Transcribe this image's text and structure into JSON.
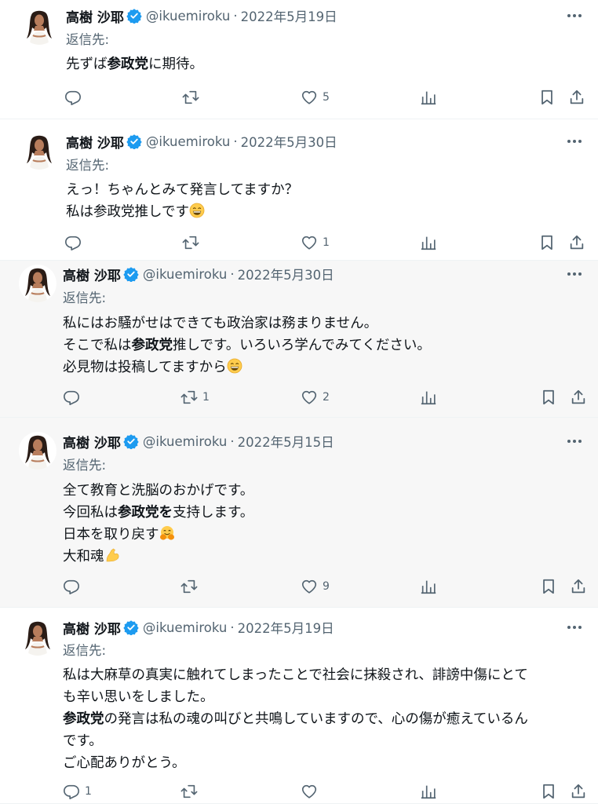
{
  "colors": {
    "text": "#0f1419",
    "muted": "#536471",
    "verified": "#1d9bf0",
    "divider": "#eff3f4",
    "hover_bg": "#f7f7f7"
  },
  "tweets": [
    {
      "name": "高樹 沙耶",
      "handle": "@ikuemiroku",
      "separator": "·",
      "date": "2022年5月19日",
      "reply_to": "返信先:",
      "lines": [
        [
          {
            "t": "先ずば"
          },
          {
            "t": "参政党",
            "b": true
          },
          {
            "t": "に期待。"
          }
        ]
      ],
      "stats": {
        "reply": "",
        "retweet": "",
        "like": "5"
      }
    },
    {
      "name": "高樹 沙耶",
      "handle": "@ikuemiroku",
      "separator": "·",
      "date": "2022年5月30日",
      "reply_to": "返信先:",
      "lines": [
        [
          {
            "t": "えっ！ちゃんとみて発言してますか？"
          }
        ],
        [
          {
            "t": "私は参政党推しです"
          },
          {
            "emoji": "grin"
          }
        ]
      ],
      "stats": {
        "reply": "",
        "retweet": "",
        "like": "1"
      }
    },
    {
      "name": "高樹 沙耶",
      "handle": "@ikuemiroku",
      "separator": "·",
      "date": "2022年5月30日",
      "reply_to": "返信先:",
      "lines": [
        [
          {
            "t": "私にはお騒がせはできても政治家は務まりません。"
          }
        ],
        [
          {
            "t": "そこで私は"
          },
          {
            "t": "参政党",
            "b": true
          },
          {
            "t": "推しです。いろいろ学んでみてください。"
          }
        ],
        [
          {
            "t": "必見物は投稿してますから"
          },
          {
            "emoji": "grin"
          }
        ]
      ],
      "stats": {
        "reply": "",
        "retweet": "1",
        "like": "2"
      }
    },
    {
      "name": "高樹 沙耶",
      "handle": "@ikuemiroku",
      "separator": "·",
      "date": "2022年5月15日",
      "reply_to": "返信先:",
      "lines": [
        [
          {
            "t": "全て教育と洗脳のおかげです。"
          }
        ],
        [
          {
            "t": "今回私は"
          },
          {
            "t": "参政党を",
            "b": true
          },
          {
            "t": "支持します。"
          }
        ],
        [
          {
            "t": "日本を取り戻す"
          },
          {
            "emoji": "hug"
          }
        ],
        [
          {
            "t": "大和魂"
          },
          {
            "emoji": "muscle"
          }
        ]
      ],
      "stats": {
        "reply": "",
        "retweet": "",
        "like": "9"
      }
    },
    {
      "name": "高樹 沙耶",
      "handle": "@ikuemiroku",
      "separator": "·",
      "date": "2022年5月19日",
      "reply_to": "返信先:",
      "lines": [
        [
          {
            "t": "私は大麻草の真実に触れてしまったことで社会に抹殺され、誹謗中傷にとて"
          }
        ],
        [
          {
            "t": "も辛い思いをしました。"
          }
        ],
        [
          {
            "t": "参政党",
            "b": true
          },
          {
            "t": "の発言は私の魂の叫びと共鳴していますので、心の傷が癒えているん"
          }
        ],
        [
          {
            "t": "です。"
          }
        ],
        [
          {
            "t": "ご心配ありがとう。"
          }
        ]
      ],
      "stats": {
        "reply": "1",
        "retweet": "",
        "like": ""
      }
    }
  ],
  "icons": {
    "reply": "reply-icon",
    "retweet": "retweet-icon",
    "like": "heart-icon",
    "views": "views-icon",
    "bookmark": "bookmark-icon",
    "share": "share-icon",
    "more": "more-icon",
    "verified": "verified-badge-icon"
  }
}
